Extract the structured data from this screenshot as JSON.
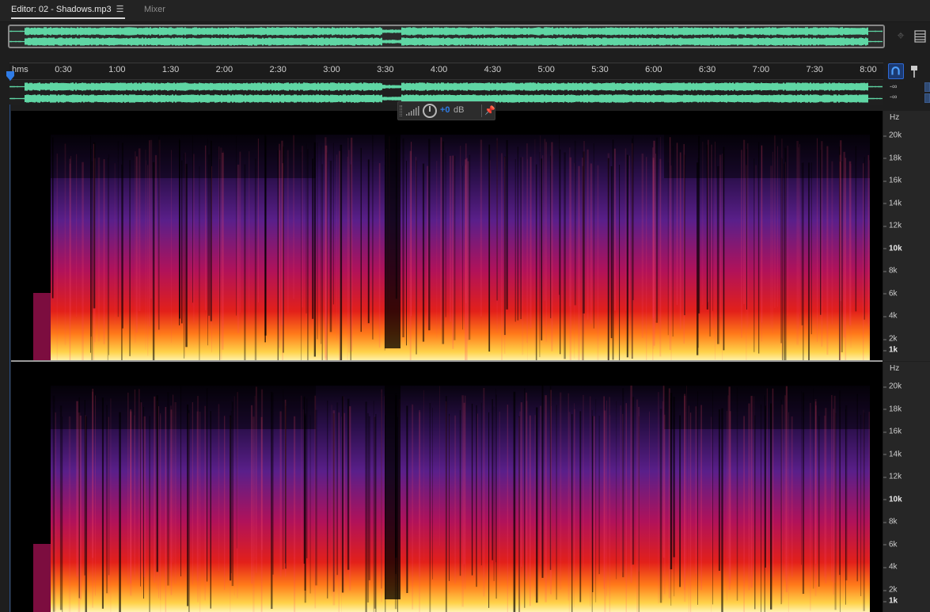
{
  "tabs": {
    "editor_label": "Editor: 02 - Shadows.mp3",
    "mixer_label": "Mixer"
  },
  "timeline": {
    "unit_label": "hms",
    "ticks": [
      "0:30",
      "1:00",
      "1:30",
      "2:00",
      "2:30",
      "3:00",
      "3:30",
      "4:00",
      "4:30",
      "5:00",
      "5:30",
      "6:00",
      "6:30",
      "7:00",
      "7:30",
      "8:00"
    ]
  },
  "meters": {
    "channel1": "-∞",
    "channel2": "-∞"
  },
  "hud": {
    "volume_value": "+0",
    "volume_unit": "dB"
  },
  "spectral": {
    "unit": "Hz",
    "ticks": [
      "20k",
      "18k",
      "16k",
      "14k",
      "12k",
      "10k",
      "8k",
      "6k",
      "4k",
      "2k",
      "1k"
    ],
    "bold_ticks": [
      "10k",
      "1k"
    ]
  },
  "colors": {
    "waveform": "#5fd6a4",
    "accent": "#2f7ce6",
    "spectrum_low": "#ffe680",
    "spectrum_mid": "#e2201a",
    "spectrum_high": "#5a1f8a"
  }
}
